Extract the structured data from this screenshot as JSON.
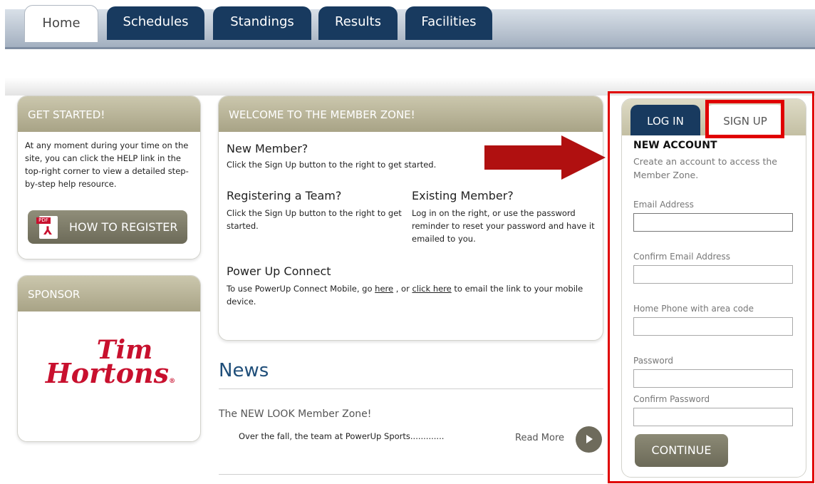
{
  "nav": {
    "tabs": [
      {
        "label": "Home",
        "active": true
      },
      {
        "label": "Schedules"
      },
      {
        "label": "Standings"
      },
      {
        "label": "Results"
      },
      {
        "label": "Facilities"
      }
    ]
  },
  "get_started": {
    "title": "GET STARTED!",
    "text": "At any moment during your time on the site, you can click the HELP link in the top-right corner to view a detailed step-by-step help resource.",
    "button_label": "HOW TO REGISTER",
    "pdf_tag": "PDF"
  },
  "sponsor": {
    "title": "SPONSOR",
    "logo_line1": "Tim",
    "logo_line2": "Hortons",
    "logo_mark": "®"
  },
  "welcome": {
    "title": "WELCOME TO THE MEMBER ZONE!",
    "new_member_heading": "New Member?",
    "new_member_text": "Click the Sign Up button to the right to get started.",
    "registering_heading": "Registering a Team?",
    "registering_text": "Click the Sign Up button to the right to get started.",
    "existing_heading": "Existing Member?",
    "existing_text": "Log in on the right, or use the password reminder to reset your password and have it emailed to you.",
    "connect_heading": "Power Up Connect",
    "connect_text_1": "To use PowerUp Connect Mobile, go ",
    "connect_link_1": "here",
    "connect_text_2": " , or ",
    "connect_link_2": "click here",
    "connect_text_3": " to email the link to your mobile device."
  },
  "news": {
    "title": "News",
    "item_title": "The NEW LOOK Member Zone!",
    "item_text": "Over the fall, the team at PowerUp Sports.............",
    "read_more": "Read More"
  },
  "signup_panel": {
    "tab_login": "LOG IN",
    "tab_signup": "SIGN UP",
    "heading": "NEW ACCOUNT",
    "description": "Create an account to access the Member Zone.",
    "fields": [
      {
        "label": "Email Address",
        "value": ""
      },
      {
        "label": "Confirm Email Address",
        "value": ""
      },
      {
        "label": "Home Phone with area code",
        "value": ""
      },
      {
        "label": "Password",
        "value": ""
      },
      {
        "label": "Confirm Password",
        "value": ""
      }
    ],
    "continue_label": "CONTINUE"
  },
  "colors": {
    "nav_tab": "#183a5f",
    "box_header": "#b3ae93",
    "button": "#7a7866",
    "highlight": "#e00000",
    "arrow": "#b01010",
    "news_title": "#1f4e79",
    "brand_red": "#c8102e"
  }
}
